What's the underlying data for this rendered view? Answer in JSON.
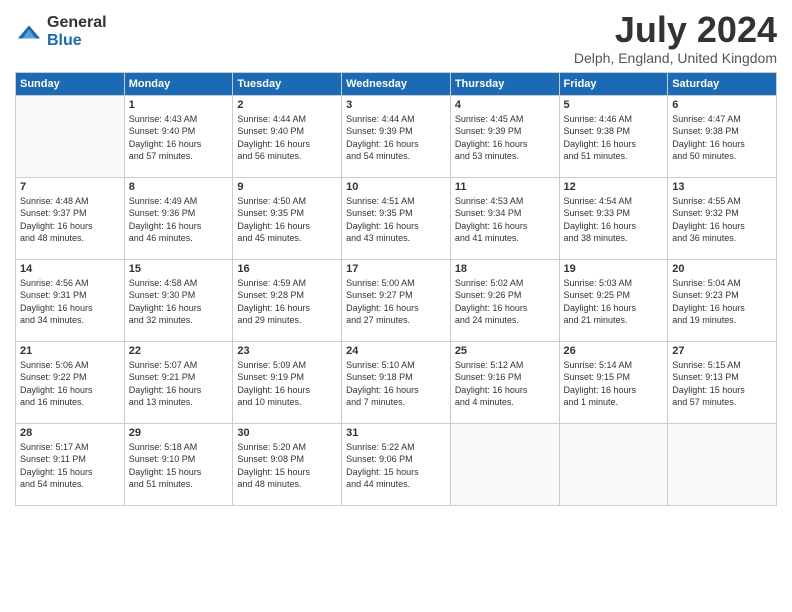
{
  "header": {
    "logo_general": "General",
    "logo_blue": "Blue",
    "month_year": "July 2024",
    "location": "Delph, England, United Kingdom"
  },
  "calendar": {
    "days_of_week": [
      "Sunday",
      "Monday",
      "Tuesday",
      "Wednesday",
      "Thursday",
      "Friday",
      "Saturday"
    ],
    "weeks": [
      [
        {
          "day": "",
          "sunrise": "",
          "sunset": "",
          "daylight": ""
        },
        {
          "day": "1",
          "sunrise": "Sunrise: 4:43 AM",
          "sunset": "Sunset: 9:40 PM",
          "daylight": "Daylight: 16 hours and 57 minutes."
        },
        {
          "day": "2",
          "sunrise": "Sunrise: 4:44 AM",
          "sunset": "Sunset: 9:40 PM",
          "daylight": "Daylight: 16 hours and 56 minutes."
        },
        {
          "day": "3",
          "sunrise": "Sunrise: 4:44 AM",
          "sunset": "Sunset: 9:39 PM",
          "daylight": "Daylight: 16 hours and 54 minutes."
        },
        {
          "day": "4",
          "sunrise": "Sunrise: 4:45 AM",
          "sunset": "Sunset: 9:39 PM",
          "daylight": "Daylight: 16 hours and 53 minutes."
        },
        {
          "day": "5",
          "sunrise": "Sunrise: 4:46 AM",
          "sunset": "Sunset: 9:38 PM",
          "daylight": "Daylight: 16 hours and 51 minutes."
        },
        {
          "day": "6",
          "sunrise": "Sunrise: 4:47 AM",
          "sunset": "Sunset: 9:38 PM",
          "daylight": "Daylight: 16 hours and 50 minutes."
        }
      ],
      [
        {
          "day": "7",
          "sunrise": "Sunrise: 4:48 AM",
          "sunset": "Sunset: 9:37 PM",
          "daylight": "Daylight: 16 hours and 48 minutes."
        },
        {
          "day": "8",
          "sunrise": "Sunrise: 4:49 AM",
          "sunset": "Sunset: 9:36 PM",
          "daylight": "Daylight: 16 hours and 46 minutes."
        },
        {
          "day": "9",
          "sunrise": "Sunrise: 4:50 AM",
          "sunset": "Sunset: 9:35 PM",
          "daylight": "Daylight: 16 hours and 45 minutes."
        },
        {
          "day": "10",
          "sunrise": "Sunrise: 4:51 AM",
          "sunset": "Sunset: 9:35 PM",
          "daylight": "Daylight: 16 hours and 43 minutes."
        },
        {
          "day": "11",
          "sunrise": "Sunrise: 4:53 AM",
          "sunset": "Sunset: 9:34 PM",
          "daylight": "Daylight: 16 hours and 41 minutes."
        },
        {
          "day": "12",
          "sunrise": "Sunrise: 4:54 AM",
          "sunset": "Sunset: 9:33 PM",
          "daylight": "Daylight: 16 hours and 38 minutes."
        },
        {
          "day": "13",
          "sunrise": "Sunrise: 4:55 AM",
          "sunset": "Sunset: 9:32 PM",
          "daylight": "Daylight: 16 hours and 36 minutes."
        }
      ],
      [
        {
          "day": "14",
          "sunrise": "Sunrise: 4:56 AM",
          "sunset": "Sunset: 9:31 PM",
          "daylight": "Daylight: 16 hours and 34 minutes."
        },
        {
          "day": "15",
          "sunrise": "Sunrise: 4:58 AM",
          "sunset": "Sunset: 9:30 PM",
          "daylight": "Daylight: 16 hours and 32 minutes."
        },
        {
          "day": "16",
          "sunrise": "Sunrise: 4:59 AM",
          "sunset": "Sunset: 9:28 PM",
          "daylight": "Daylight: 16 hours and 29 minutes."
        },
        {
          "day": "17",
          "sunrise": "Sunrise: 5:00 AM",
          "sunset": "Sunset: 9:27 PM",
          "daylight": "Daylight: 16 hours and 27 minutes."
        },
        {
          "day": "18",
          "sunrise": "Sunrise: 5:02 AM",
          "sunset": "Sunset: 9:26 PM",
          "daylight": "Daylight: 16 hours and 24 minutes."
        },
        {
          "day": "19",
          "sunrise": "Sunrise: 5:03 AM",
          "sunset": "Sunset: 9:25 PM",
          "daylight": "Daylight: 16 hours and 21 minutes."
        },
        {
          "day": "20",
          "sunrise": "Sunrise: 5:04 AM",
          "sunset": "Sunset: 9:23 PM",
          "daylight": "Daylight: 16 hours and 19 minutes."
        }
      ],
      [
        {
          "day": "21",
          "sunrise": "Sunrise: 5:06 AM",
          "sunset": "Sunset: 9:22 PM",
          "daylight": "Daylight: 16 hours and 16 minutes."
        },
        {
          "day": "22",
          "sunrise": "Sunrise: 5:07 AM",
          "sunset": "Sunset: 9:21 PM",
          "daylight": "Daylight: 16 hours and 13 minutes."
        },
        {
          "day": "23",
          "sunrise": "Sunrise: 5:09 AM",
          "sunset": "Sunset: 9:19 PM",
          "daylight": "Daylight: 16 hours and 10 minutes."
        },
        {
          "day": "24",
          "sunrise": "Sunrise: 5:10 AM",
          "sunset": "Sunset: 9:18 PM",
          "daylight": "Daylight: 16 hours and 7 minutes."
        },
        {
          "day": "25",
          "sunrise": "Sunrise: 5:12 AM",
          "sunset": "Sunset: 9:16 PM",
          "daylight": "Daylight: 16 hours and 4 minutes."
        },
        {
          "day": "26",
          "sunrise": "Sunrise: 5:14 AM",
          "sunset": "Sunset: 9:15 PM",
          "daylight": "Daylight: 16 hours and 1 minute."
        },
        {
          "day": "27",
          "sunrise": "Sunrise: 5:15 AM",
          "sunset": "Sunset: 9:13 PM",
          "daylight": "Daylight: 15 hours and 57 minutes."
        }
      ],
      [
        {
          "day": "28",
          "sunrise": "Sunrise: 5:17 AM",
          "sunset": "Sunset: 9:11 PM",
          "daylight": "Daylight: 15 hours and 54 minutes."
        },
        {
          "day": "29",
          "sunrise": "Sunrise: 5:18 AM",
          "sunset": "Sunset: 9:10 PM",
          "daylight": "Daylight: 15 hours and 51 minutes."
        },
        {
          "day": "30",
          "sunrise": "Sunrise: 5:20 AM",
          "sunset": "Sunset: 9:08 PM",
          "daylight": "Daylight: 15 hours and 48 minutes."
        },
        {
          "day": "31",
          "sunrise": "Sunrise: 5:22 AM",
          "sunset": "Sunset: 9:06 PM",
          "daylight": "Daylight: 15 hours and 44 minutes."
        },
        {
          "day": "",
          "sunrise": "",
          "sunset": "",
          "daylight": ""
        },
        {
          "day": "",
          "sunrise": "",
          "sunset": "",
          "daylight": ""
        },
        {
          "day": "",
          "sunrise": "",
          "sunset": "",
          "daylight": ""
        }
      ]
    ]
  }
}
